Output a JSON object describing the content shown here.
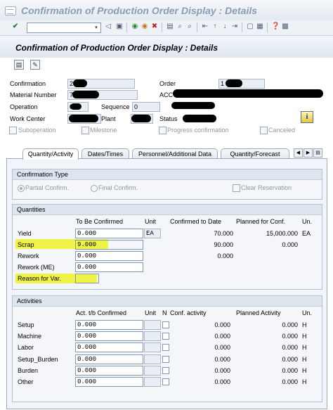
{
  "window": {
    "title": "Confirmation of Production Order Display : Details"
  },
  "toolbar": {
    "command_value": "",
    "dropdown_glyph": "▾"
  },
  "screen": {
    "title": "Confirmation of Production Order Display : Details"
  },
  "header": {
    "confirmation_label": "Confirmation",
    "confirmation_value": "2",
    "order_label": "Order",
    "order_value": "1",
    "material_label": "Material Number",
    "material_value": "7",
    "material_desc": "ACC",
    "operation_label": "Operation",
    "operation_value": "0",
    "sequence_label": "Sequence",
    "sequence_value": "0",
    "work_center_label": "Work Center",
    "plant_label": "Plant",
    "status_label": "Status",
    "info_icon": "i",
    "suboperation_label": "Suboperation",
    "milestone_label": "Milestone",
    "progress_label": "Progress confirmation",
    "canceled_label": "Canceled"
  },
  "tabs": [
    {
      "label": "Quantity/Activity"
    },
    {
      "label": "Dates/Times"
    },
    {
      "label": "Personnel/Additional Data"
    },
    {
      "label": "Quantity/Forecast"
    }
  ],
  "confirmation_type": {
    "title": "Confirmation Type",
    "partial": "Partial Confirm.",
    "final": "Final Confirm.",
    "clear": "Clear Reservation"
  },
  "quantities": {
    "title": "Quantities",
    "col_to_be_confirmed": "To Be Confirmed",
    "col_unit": "Unit",
    "col_confirmed_to_date": "Confirmed to Date",
    "col_planned": "Planned for Conf.",
    "col_un": "Un.",
    "rows": [
      {
        "label": "Yield",
        "to_be": "0.000",
        "unit": "EA",
        "confirmed": "70.000",
        "planned": "15,000.000",
        "un": "EA"
      },
      {
        "label": "Scrap",
        "to_be": "9.000",
        "unit": "",
        "confirmed": "90.000",
        "planned": "0.000",
        "un": ""
      },
      {
        "label": "Rework",
        "to_be": "0.000",
        "unit": "",
        "confirmed": "0.000",
        "planned": "",
        "un": ""
      },
      {
        "label": "Rework (ME)",
        "to_be": "0.000",
        "unit": "",
        "confirmed": "",
        "planned": "",
        "un": ""
      },
      {
        "label": "Reason for Var.",
        "to_be": "",
        "unit": "",
        "confirmed": "",
        "planned": "",
        "un": ""
      }
    ]
  },
  "activities": {
    "title": "Activities",
    "col_act": "Act. t/b Confirmed",
    "col_unit": "Unit",
    "col_n": "N",
    "col_conf": "Conf. activity",
    "col_planned": "Planned Activity",
    "col_un": "Un.",
    "rows": [
      {
        "label": "Setup",
        "act": "0.000",
        "conf": "0.000",
        "planned": "0.000",
        "un": "H"
      },
      {
        "label": "Machine",
        "act": "0.000",
        "conf": "0.000",
        "planned": "0.000",
        "un": "H"
      },
      {
        "label": "Labor",
        "act": "0.000",
        "conf": "0.000",
        "planned": "0.000",
        "un": "H"
      },
      {
        "label": "Setup_Burden",
        "act": "0.000",
        "conf": "0.000",
        "planned": "0.000",
        "un": "H"
      },
      {
        "label": "Burden",
        "act": "0.000",
        "conf": "0.000",
        "planned": "0.000",
        "un": "H"
      },
      {
        "label": "Other",
        "act": "0.000",
        "conf": "0.000",
        "planned": "0.000",
        "un": "H"
      }
    ]
  },
  "colors": {
    "highlight": "#eef233",
    "title_text": "#8a9cb2"
  }
}
